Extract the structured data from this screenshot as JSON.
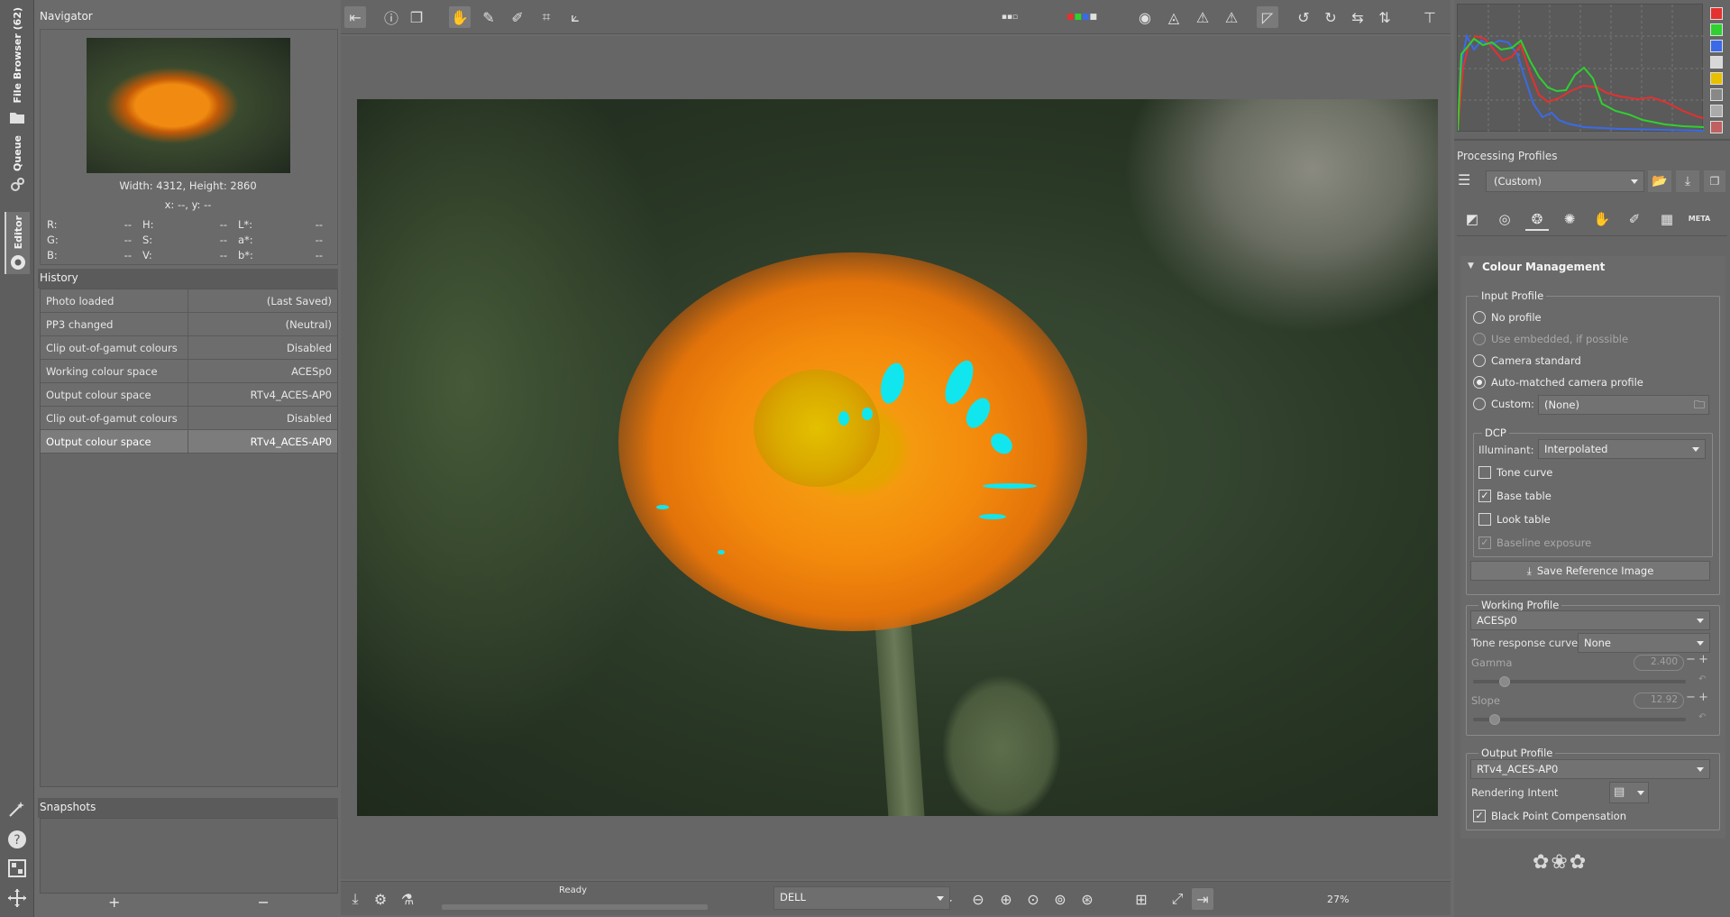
{
  "vtabs": {
    "file_browser": "File Browser (62)",
    "queue": "Queue",
    "editor": "Editor"
  },
  "navigator": {
    "title": "Navigator",
    "size": "Width: 4312, Height: 2860",
    "coords": "x: --, y: --",
    "rows": [
      [
        {
          "k": "R:",
          "v": "--"
        },
        {
          "k": "H:",
          "v": "--"
        },
        {
          "k": "L*:",
          "v": "--"
        }
      ],
      [
        {
          "k": "G:",
          "v": "--"
        },
        {
          "k": "S:",
          "v": "--"
        },
        {
          "k": "a*:",
          "v": "--"
        }
      ],
      [
        {
          "k": "B:",
          "v": "--"
        },
        {
          "k": "V:",
          "v": "--"
        },
        {
          "k": "b*:",
          "v": "--"
        }
      ]
    ]
  },
  "history": {
    "title": "History",
    "items": [
      {
        "action": "Photo loaded",
        "value": "(Last Saved)"
      },
      {
        "action": "PP3 changed",
        "value": "(Neutral)"
      },
      {
        "action": "Clip out-of-gamut colours",
        "value": "Disabled"
      },
      {
        "action": "Working colour space",
        "value": "ACESp0"
      },
      {
        "action": "Output colour space",
        "value": "RTv4_ACES-AP0"
      },
      {
        "action": "Clip out-of-gamut colours",
        "value": "Disabled"
      },
      {
        "action": "Output colour space",
        "value": "RTv4_ACES-AP0"
      }
    ]
  },
  "snapshots": {
    "title": "Snapshots",
    "add": "+",
    "remove": "−"
  },
  "statusbar": {
    "status": "Ready",
    "monitor_profile": "DELL",
    "zoom": "27%"
  },
  "processing_profiles": {
    "title": "Processing Profiles",
    "selected": "(Custom)"
  },
  "tool_tabs": [
    "exposure-icon",
    "detail-icon",
    "colour-icon",
    "advanced-icon",
    "transform-icon",
    "raw-icon",
    "locallab-icon",
    "META"
  ],
  "colour_management": {
    "title": "Colour Management",
    "input_profile": {
      "title": "Input Profile",
      "options": [
        {
          "label": "No profile",
          "selected": false,
          "disabled": false
        },
        {
          "label": "Use embedded, if possible",
          "selected": false,
          "disabled": true
        },
        {
          "label": "Camera standard",
          "selected": false,
          "disabled": false
        },
        {
          "label": "Auto-matched camera profile",
          "selected": true,
          "disabled": false
        }
      ],
      "custom_label": "Custom:",
      "custom_value": "(None)"
    },
    "dcp": {
      "title": "DCP",
      "illuminant_label": "Illuminant:",
      "illuminant_value": "Interpolated",
      "checks": [
        {
          "label": "Tone curve",
          "checked": false,
          "disabled": false
        },
        {
          "label": "Base table",
          "checked": true,
          "disabled": false
        },
        {
          "label": "Look table",
          "checked": false,
          "disabled": false
        },
        {
          "label": "Baseline exposure",
          "checked": true,
          "disabled": true
        }
      ]
    },
    "save_reference": "Save Reference Image",
    "working_profile": {
      "title": "Working Profile",
      "value": "ACESp0",
      "trc_label": "Tone response curve:",
      "trc_value": "None",
      "gamma_label": "Gamma",
      "gamma_value": "2.400",
      "slope_label": "Slope",
      "slope_value": "12.92"
    },
    "output_profile": {
      "title": "Output Profile",
      "value": "RTv4_ACES-AP0",
      "intent_label": "Rendering Intent",
      "bpc_label": "Black Point Compensation",
      "bpc_checked": true
    }
  },
  "colors": {
    "clip_indicator": "#11e6ee",
    "hist_red": "#e53030",
    "hist_green": "#2fd02f",
    "hist_blue": "#3a6ae8"
  }
}
